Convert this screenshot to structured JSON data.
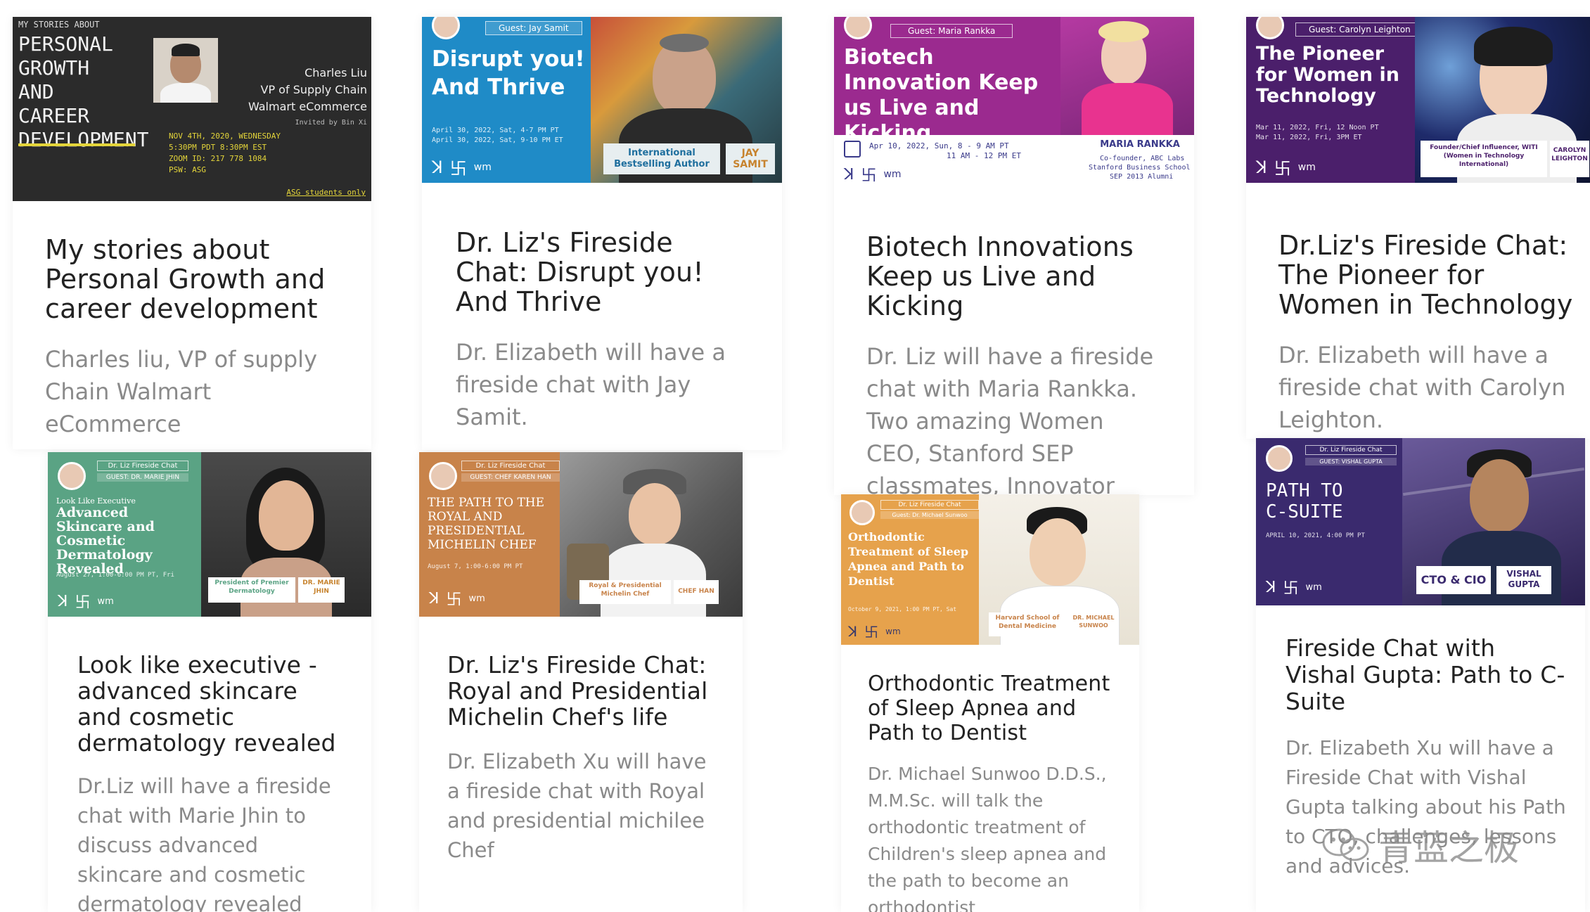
{
  "cards": [
    {
      "title": "My stories about Personal Growth and career development",
      "description": "Charles liu, VP of supply Chain Walmart eCommerce",
      "banner": {
        "header": "MY STORIES ABOUT",
        "title": "PERSONAL GROWTH AND CAREER DEVELOPMENT",
        "person_name": "Charles Liu",
        "person_role": "VP of Supply Chain",
        "person_company": "Walmart eCommerce",
        "host": "Invited by Bin Xi",
        "date": "NOV 4TH, 2020, WEDNESDAY",
        "time": "5:30PM PDT 8:30PM EST",
        "zoom": "ZOOM ID: 217 778 1084",
        "pwd": "PSW: ASG",
        "footer": "ASG students only"
      }
    },
    {
      "title": "Dr. Liz's Fireside Chat: Disrupt you! And Thrive",
      "description": "Dr. Elizabeth will have a fireside chat with Jay Samit.",
      "banner": {
        "guest": "Guest: Jay Samit",
        "title": "Disrupt you! And Thrive",
        "date1": "April 30, 2022, Sat, 4-7 PM PT",
        "date2": "April 30, 2022, Sat, 9-10 PM ET",
        "tag": "International Bestselling Author",
        "name": "JAY SAMIT"
      }
    },
    {
      "title": "Biotech Innovations Keep us Live and Kicking",
      "description": "Dr. Liz will have a fireside chat with Maria Rankka. Two amazing Women CEO, Stanford SEP classmates, Innovator and Investors.",
      "banner": {
        "guest": "Guest: Maria Rankka",
        "title": "Biotech Innovation Keep us Live and Kicking",
        "date": "Apr 10, 2022, Sun, 8 - 9 AM PT",
        "date2": "11 AM - 12 PM ET",
        "name": "MARIA RANKKA",
        "role": "Co-founder, ABC Labs",
        "school": "Stanford Business School",
        "sep": "SEP 2013 Alumni"
      }
    },
    {
      "title": "Dr.Liz's Fireside Chat: The Pioneer for Women in Technology",
      "description": "Dr. Elizabeth will have a fireside chat with Carolyn Leighton.",
      "banner": {
        "guest": "Guest: Carolyn Leighton",
        "title": "The Pioneer for Women in Technology",
        "date1": "Mar 11, 2022, Fri, 12 Noon PT",
        "date2": "Mar 11, 2022, Fri, 3PM ET",
        "tag": "Founder/Chief Influencer, WITI (Women in Technology International)",
        "name": "CAROLYN LEIGHTON"
      }
    },
    {
      "title": "Look like executive - advanced skincare and cosmetic dermatology revealed",
      "description": "Dr.Liz will have a fireside chat with Marie Jhin to discuss advanced skincare and cosmetic dermatology revealed",
      "banner": {
        "header": "Dr. Liz Fireside Chat",
        "guest": "GUEST: DR. MARIE JHIN",
        "title_small": "Look Like Executive",
        "title": "Advanced Skincare and Cosmetic Dermatology Revealed",
        "date": "August 27, 1:00-6:00 PM PT, Fri",
        "tag": "President of Premier Dermatology",
        "name": "DR. MARIE JHIN"
      }
    },
    {
      "title": "Dr. Liz's Fireside Chat: Royal and Presidential Michelin Chef's life",
      "description": "Dr. Elizabeth Xu will have a fireside chat with Royal and presidential michilee Chef",
      "banner": {
        "header": "Dr. Liz Fireside Chat",
        "guest": "GUEST: CHEF KAREN HAN",
        "title": "THE PATH TO THE ROYAL AND PRESIDENTIAL MICHELIN CHEF",
        "date": "August 7, 1:00-6:00 PM PT",
        "tag": "Royal & Presidential Michelin Chef",
        "name": "CHEF HAN"
      }
    },
    {
      "title": "Orthodontic Treatment of Sleep Apnea and Path to Dentist",
      "description": "Dr. Michael Sunwoo D.D.S., M.M.Sc. will talk the orthodontic treatment of Children's sleep apnea and the path to become an orthodontist",
      "banner": {
        "header": "Dr. Liz Fireside Chat",
        "guest": "Guest: Dr. Michael Sunwoo",
        "title": "Orthodontic Treatment of Sleep Apnea and Path to Dentist",
        "date": "October 9, 2021, 1:00 PM PT, Sat",
        "tag": "Harvard School of Dental Medicine",
        "name": "DR. MICHAEL SUNWOO"
      }
    },
    {
      "title": "Fireside Chat with Vishal Gupta: Path to C-Suite",
      "description": "Dr. Elizabeth Xu will have a Fireside Chat with Vishal Gupta talking about his Path to CTO, challenges, lessons and advices.",
      "banner": {
        "header": "Dr. Liz Fireside Chat",
        "guest": "GUEST: VISHAL GUPTA",
        "title": "PATH TO C-SUITE",
        "date": "APRIL 10, 2021, 4:00 PM PT",
        "tag": "CTO & CIO",
        "name": "VISHAL GUPTA"
      }
    }
  ],
  "watermark": "青蓝之极",
  "colors": {
    "dark": "#2b2b2b",
    "blue": "#1f8bc7",
    "purple": "#9b2a8f",
    "violet": "#4b1f6b",
    "green": "#5aa384",
    "orange": "#c8834a",
    "gold": "#e6a24c",
    "navy": "#3a2a6e"
  }
}
